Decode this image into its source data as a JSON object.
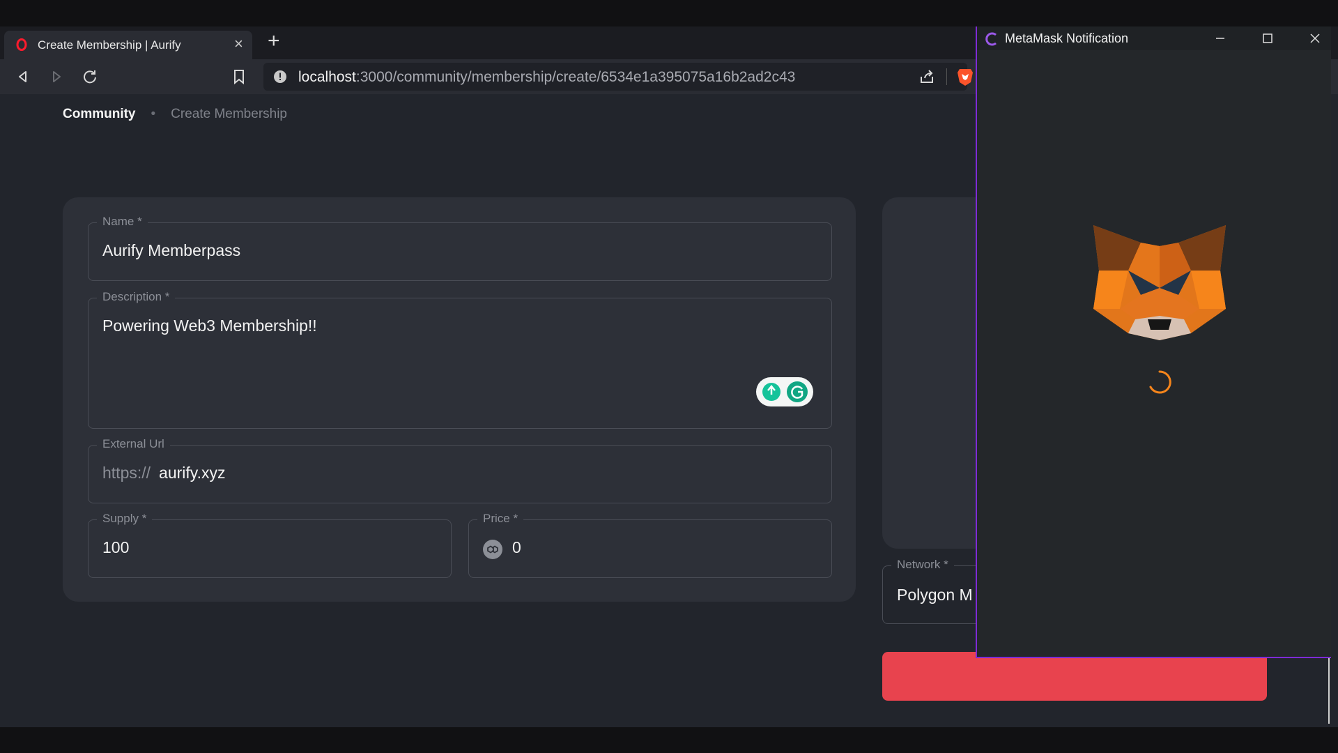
{
  "browser": {
    "tab_title": "Create Membership | Aurify",
    "url_host": "localhost",
    "url_path": ":3000/community/membership/create/6534e1a395075a16b2ad2c43"
  },
  "breadcrumb": {
    "parent": "Community",
    "current": "Create Membership"
  },
  "form": {
    "name_label": "Name *",
    "name_value": "Aurify Memberpass",
    "description_label": "Description *",
    "description_value": "Powering Web3 Membership!!",
    "external_url_label": "External Url",
    "external_url_prefix": "https://",
    "external_url_value": "aurify.xyz",
    "supply_label": "Supply *",
    "supply_value": "100",
    "price_label": "Price *",
    "price_value": "0",
    "network_label": "Network *",
    "network_value": "Polygon M"
  },
  "metamask": {
    "window_title": "MetaMask Notification"
  },
  "colors": {
    "accent": "#e8434e",
    "metamask_border": "#7e2bd6",
    "fox_orange": "#e2761b"
  }
}
